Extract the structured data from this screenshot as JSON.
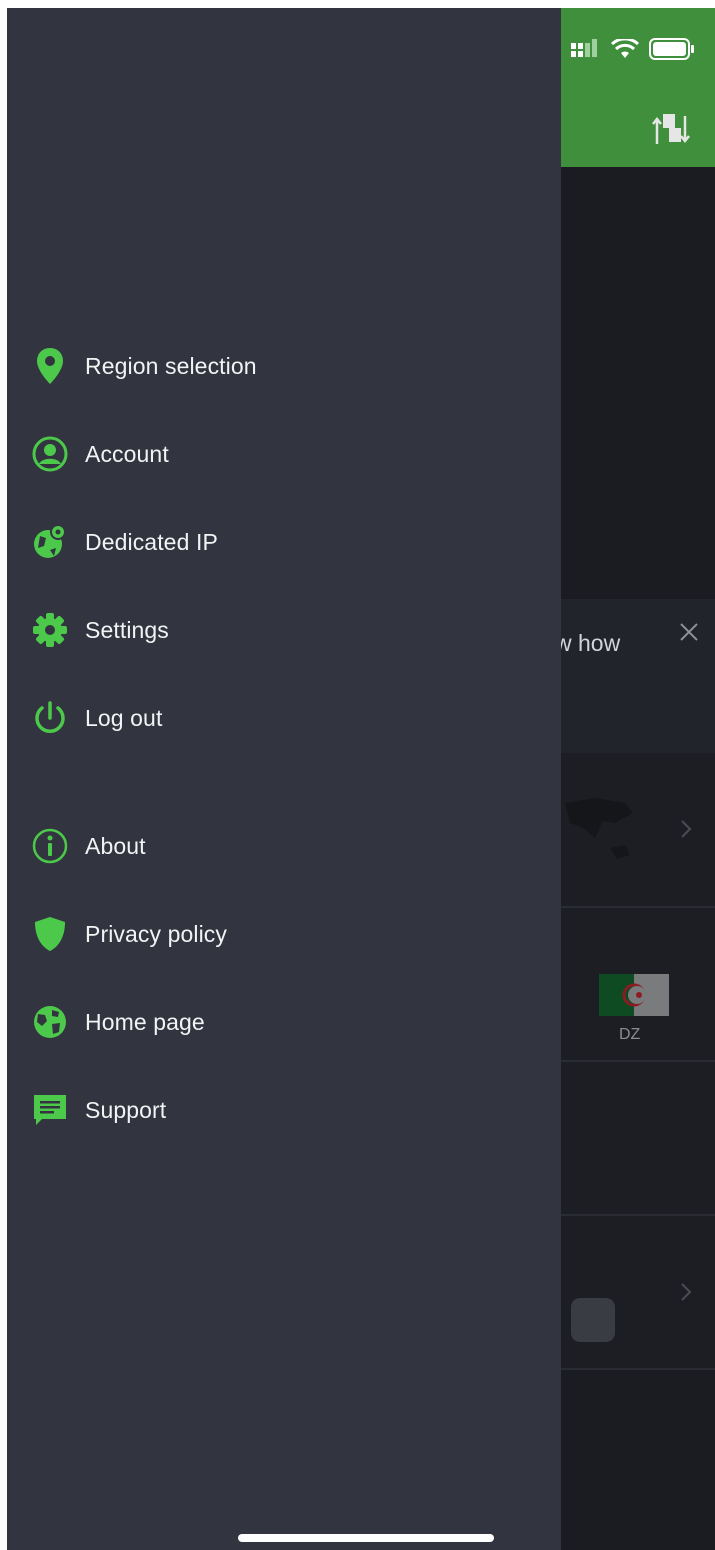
{
  "background_app": {
    "header_color": "#3f8f3d",
    "promo_text": "w how",
    "country_code": "DZ"
  },
  "drawer": {
    "items": [
      {
        "label": "Region selection",
        "icon": "location-pin-icon"
      },
      {
        "label": "Account",
        "icon": "account-circle-icon"
      },
      {
        "label": "Dedicated IP",
        "icon": "globe-pin-icon"
      },
      {
        "label": "Settings",
        "icon": "gear-icon"
      },
      {
        "label": "Log out",
        "icon": "power-icon"
      },
      {
        "label": "About",
        "icon": "info-icon"
      },
      {
        "label": "Privacy policy",
        "icon": "shield-icon"
      },
      {
        "label": "Home page",
        "icon": "globe-icon"
      },
      {
        "label": "Support",
        "icon": "chat-icon"
      }
    ]
  },
  "colors": {
    "accent": "#4cc94a",
    "drawer_bg": "#32353f",
    "text": "#f2f3f5"
  }
}
